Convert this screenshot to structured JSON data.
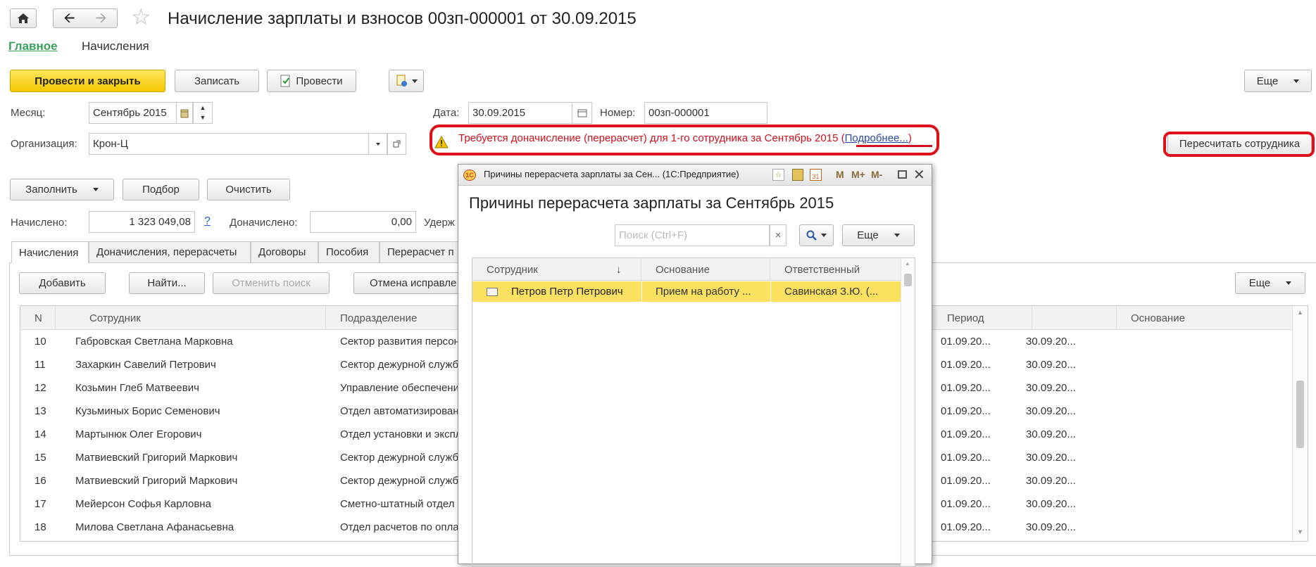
{
  "header": {
    "title": "Начисление зарплаты и взносов 00зп-000001 от 30.09.2015",
    "nav_links": [
      "Главное",
      "Начисления"
    ]
  },
  "toolbar": {
    "post_close": "Провести и закрыть",
    "save": "Записать",
    "post": "Провести",
    "more": "Еще"
  },
  "form": {
    "month_label": "Месяц:",
    "month_value": "Сентябрь 2015",
    "date_label": "Дата:",
    "date_value": "30.09.2015",
    "number_label": "Номер:",
    "number_value": "00зп-000001",
    "org_label": "Организация:",
    "org_value": "Крон-Ц",
    "warning_text": "Требуется доначисление (перерасчет) для 1-го сотрудника за Сентябрь 2015 (",
    "warning_link": "Подробнее...",
    "warning_close": ")",
    "recalc_button": "Пересчитать сотрудника"
  },
  "actions": {
    "fill": "Заполнить",
    "pick": "Подбор",
    "clear": "Очистить"
  },
  "totals": {
    "accrued_label": "Начислено:",
    "accrued_value": "1 323 049,08",
    "help": "?",
    "extra_label": "Доначислено:",
    "extra_value": "0,00",
    "withheld_label": "Удерж"
  },
  "tabs": [
    "Начисления",
    "Доначисления, перерасчеты",
    "Договоры",
    "Пособия",
    "Перерасчет п"
  ],
  "tab_toolbar": {
    "add": "Добавить",
    "find": "Найти...",
    "cancel_search": "Отменить поиск",
    "cancel_fix": "Отмена исправле",
    "more": "Еще"
  },
  "table": {
    "columns": [
      "N",
      "Сотрудник",
      "Подразделение",
      "Период",
      "",
      "Основание"
    ],
    "rows": [
      {
        "n": "10",
        "name": "Габровская Светлана Марковна",
        "dept": "Сектор развития персонал",
        "from": "01.09.20...",
        "to": "30.09.20..."
      },
      {
        "n": "11",
        "name": "Захаркин Савелий Петрович",
        "dept": "Сектор дежурной службы",
        "from": "01.09.20...",
        "to": "30.09.20..."
      },
      {
        "n": "12",
        "name": "Козьмин Глеб Матвеевич",
        "dept": "Управление обеспечения б",
        "from": "01.09.20...",
        "to": "30.09.20..."
      },
      {
        "n": "13",
        "name": "Кузьминых Борис Семенович",
        "dept": "Отдел автоматизированны",
        "from": "01.09.20...",
        "to": "30.09.20..."
      },
      {
        "n": "14",
        "name": "Мартынюк Олег Егорович",
        "dept": "Отдел установки и эксплуат",
        "from": "01.09.20...",
        "to": "30.09.20..."
      },
      {
        "n": "15",
        "name": "Матвиевский Григорий Маркович",
        "dept": "Сектор дежурной службы",
        "from": "01.09.20...",
        "to": "30.09.20..."
      },
      {
        "n": "16",
        "name": "Матвиевский Григорий Маркович",
        "dept": "Сектор дежурной службы",
        "from": "01.09.20...",
        "to": "30.09.20..."
      },
      {
        "n": "17",
        "name": "Мейерсон Софья Карловна",
        "dept": "Сметно-штатный отдел",
        "from": "01.09.20...",
        "to": "30.09.20..."
      },
      {
        "n": "18",
        "name": "Милова Светлана Афанасьевна",
        "dept": "Отдел расчетов по оплате т",
        "from": "01.09.20...",
        "to": "30.09.20..."
      }
    ]
  },
  "popup": {
    "window_title": "Причины перерасчета зарплаты за Сен... (1С:Предприятие)",
    "heading": "Причины перерасчета зарплаты за Сентябрь 2015",
    "search_placeholder": "Поиск (Ctrl+F)",
    "search_clear": "×",
    "more": "Еще",
    "title_buttons": [
      "M",
      "M+",
      "M-"
    ],
    "columns": [
      "Сотрудник",
      "Основание",
      "Ответственный"
    ],
    "sort_arrow": "↓",
    "rows": [
      {
        "employee": "Петров Петр Петрович",
        "reason": "Прием на работу ...",
        "responsible": "Савинская З.Ю. (..."
      }
    ]
  },
  "colors": {
    "accent_yellow": "#f5c800",
    "link_green": "#3aa15c",
    "warning_red": "#d0101a",
    "highlight_oval": "#e0101a",
    "selected_row": "#fbe15f"
  }
}
